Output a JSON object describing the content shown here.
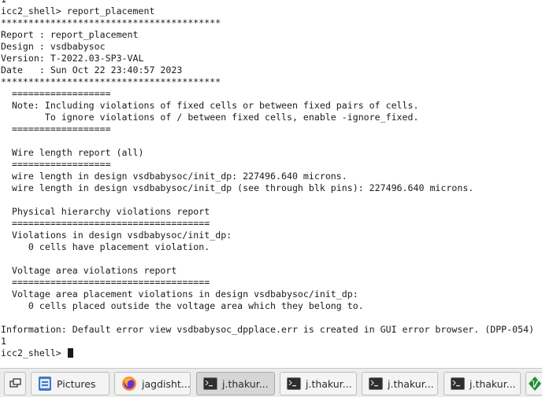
{
  "terminal": {
    "lines": [
      "1",
      "icc2_shell> report_placement",
      "****************************************",
      "Report : report_placement",
      "Design : vsdbabysoc",
      "Version: T-2022.03-SP3-VAL",
      "Date   : Sun Oct 22 23:40:57 2023",
      "****************************************",
      "  ==================",
      "  Note: Including violations of fixed cells or between fixed pairs of cells.",
      "        To ignore violations of / between fixed cells, enable -ignore_fixed.",
      "  ==================",
      "",
      "  Wire length report (all)",
      "  ==================",
      "  wire length in design vsdbabysoc/init_dp: 227496.640 microns.",
      "  wire length in design vsdbabysoc/init_dp (see through blk pins): 227496.640 microns.",
      "",
      "  Physical hierarchy violations report",
      "  ====================================",
      "  Violations in design vsdbabysoc/init_dp:",
      "     0 cells have placement violation.",
      "",
      "  Voltage area violations report",
      "  ====================================",
      "  Voltage area placement violations in design vsdbabysoc/init_dp:",
      "     0 cells placed outside the voltage area which they belong to.",
      "",
      "Information: Default error view vsdbabysoc_dpplace.err is created in GUI error browser. (DPP-054)",
      "1",
      "icc2_shell> "
    ]
  },
  "taskbar": {
    "buttons": [
      {
        "label": "",
        "icon": "show-desktop-icon",
        "active": false
      },
      {
        "label": "Pictures",
        "icon": "file-manager-icon",
        "active": false
      },
      {
        "label": "jagdisht...",
        "icon": "firefox-icon",
        "active": false
      },
      {
        "label": "j.thakur...",
        "icon": "terminal-icon",
        "active": true
      },
      {
        "label": "j.thakur...",
        "icon": "terminal-icon",
        "active": false
      },
      {
        "label": "j.thakur...",
        "icon": "terminal-icon",
        "active": false
      },
      {
        "label": "j.thakur...",
        "icon": "terminal-icon",
        "active": false
      },
      {
        "label": "",
        "icon": "vim-icon",
        "active": false
      }
    ]
  },
  "colors": {
    "terminal_bg": "#ffffff",
    "terminal_fg": "#1a1a1a",
    "taskbar_bg": "#ececec",
    "active_button_bg": "#d6d6d6"
  }
}
